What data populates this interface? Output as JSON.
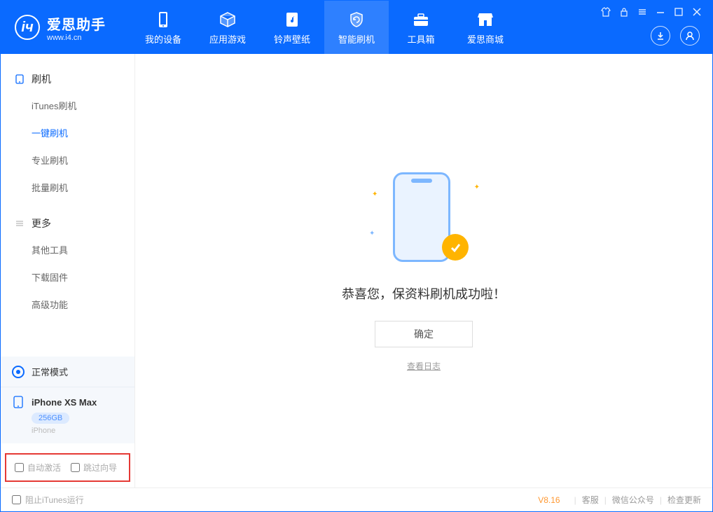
{
  "header": {
    "logo_title": "爱思助手",
    "logo_sub": "www.i4.cn",
    "tabs": [
      {
        "label": "我的设备"
      },
      {
        "label": "应用游戏"
      },
      {
        "label": "铃声壁纸"
      },
      {
        "label": "智能刷机"
      },
      {
        "label": "工具箱"
      },
      {
        "label": "爱思商城"
      }
    ]
  },
  "sidebar": {
    "groups": [
      {
        "title": "刷机",
        "items": [
          "iTunes刷机",
          "一键刷机",
          "专业刷机",
          "批量刷机"
        ]
      },
      {
        "title": "更多",
        "items": [
          "其他工具",
          "下载固件",
          "高级功能"
        ]
      }
    ],
    "mode": "正常模式",
    "device": {
      "name": "iPhone XS Max",
      "storage": "256GB",
      "type": "iPhone"
    },
    "options": [
      "自动激活",
      "跳过向导"
    ]
  },
  "main": {
    "success_message": "恭喜您，保资料刷机成功啦！",
    "ok_button": "确定",
    "view_log": "查看日志"
  },
  "footer": {
    "block_itunes": "阻止iTunes运行",
    "version": "V8.16",
    "links": [
      "客服",
      "微信公众号",
      "检查更新"
    ]
  }
}
